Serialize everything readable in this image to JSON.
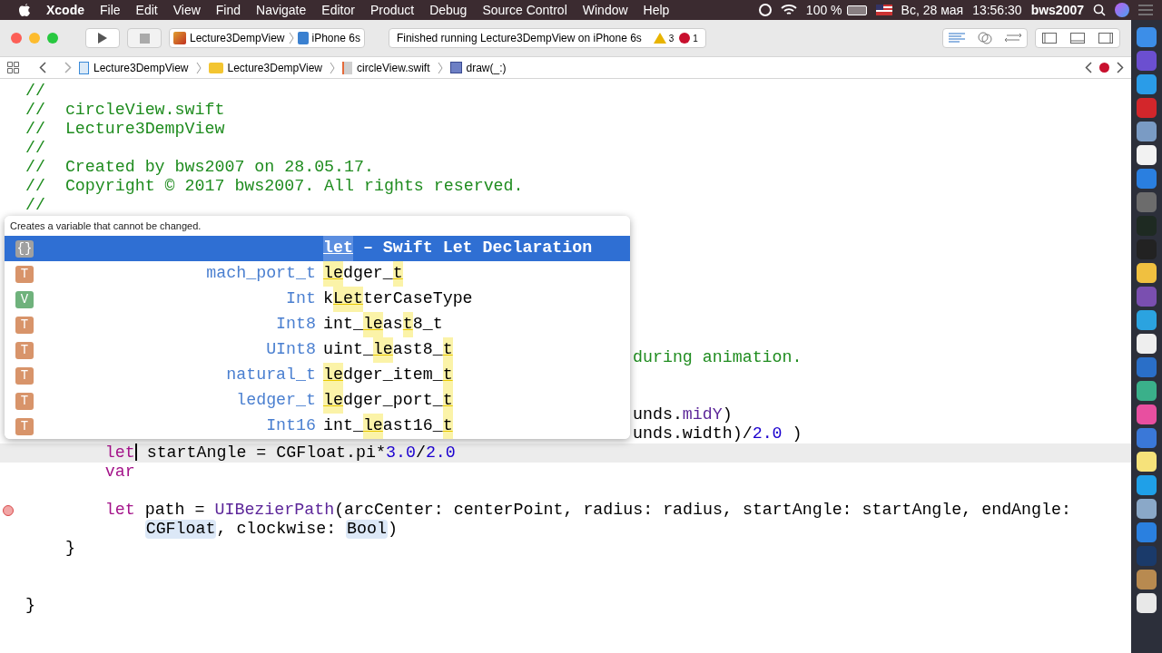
{
  "menu_bar": {
    "app": "Xcode",
    "items": [
      "File",
      "Edit",
      "View",
      "Find",
      "Navigate",
      "Editor",
      "Product",
      "Debug",
      "Source Control",
      "Window",
      "Help"
    ],
    "battery": "100 %",
    "date": "Вс, 28 мая",
    "time": "13:56:30",
    "user": "bws2007"
  },
  "toolbar": {
    "scheme": "Lecture3DempView",
    "device": "iPhone 6s",
    "status": "Finished running Lecture3DempView on iPhone 6s",
    "warnings": "3",
    "errors": "1"
  },
  "breadcrumbs": [
    {
      "kind": "project",
      "label": "Lecture3DempView"
    },
    {
      "kind": "folder",
      "label": "Lecture3DempView"
    },
    {
      "kind": "swift",
      "label": "circleView.swift"
    },
    {
      "kind": "method",
      "label": "draw(_:)"
    }
  ],
  "lines": [
    {
      "segments": [
        {
          "kind": "comment",
          "text": "//"
        }
      ]
    },
    {
      "segments": [
        {
          "kind": "comment",
          "text": "//  circleView.swift"
        }
      ]
    },
    {
      "segments": [
        {
          "kind": "comment",
          "text": "//  Lecture3DempView"
        }
      ]
    },
    {
      "segments": [
        {
          "kind": "comment",
          "text": "//"
        }
      ]
    },
    {
      "segments": [
        {
          "kind": "comment",
          "text": "//  Created by bws2007 on 28.05.17."
        }
      ]
    },
    {
      "segments": [
        {
          "kind": "comment",
          "text": "//  Copyright © 2017 bws2007. All rights reserved."
        }
      ]
    },
    {
      "segments": [
        {
          "kind": "comment",
          "text": "//"
        }
      ]
    },
    {
      "kind": "blank"
    },
    {
      "kind": "blank"
    },
    {
      "kind": "blank"
    },
    {
      "kind": "blank"
    },
    {
      "kind": "blank"
    },
    {
      "kind": "blank"
    },
    {
      "kind": "blank"
    },
    {
      "covered": true,
      "segments": [
        {
          "kind": "comment",
          "text": "during animation."
        }
      ]
    },
    {
      "kind": "blank"
    },
    {
      "kind": "blank"
    },
    {
      "covered": true,
      "segments": [
        {
          "kind": "plain",
          "text": "unds."
        },
        {
          "kind": "property",
          "text": "midY"
        },
        {
          "kind": "plain",
          "text": ")"
        }
      ]
    },
    {
      "covered": true,
      "segments": [
        {
          "kind": "plain",
          "text": "unds.width)/"
        },
        {
          "kind": "number",
          "text": "2.0"
        },
        {
          "kind": "plain",
          "text": " )"
        }
      ]
    },
    {
      "current": true,
      "segments": [
        {
          "kind": "keyword",
          "text": "        let",
          "caret_after": true
        },
        {
          "kind": "plain",
          "text": " startAngle = CGFloat.pi*"
        },
        {
          "kind": "number",
          "text": "3.0"
        },
        {
          "kind": "plain",
          "text": "/"
        },
        {
          "kind": "number",
          "text": "2.0"
        }
      ]
    },
    {
      "segments": [
        {
          "kind": "keyword",
          "text": "        var"
        }
      ]
    },
    {
      "kind": "blank"
    },
    {
      "error": true,
      "segments": [
        {
          "kind": "keyword",
          "text": "        let"
        },
        {
          "kind": "plain",
          "text": " path = "
        },
        {
          "kind": "type",
          "text": "UIBezierPath"
        },
        {
          "kind": "plain",
          "text": "(arcCenter: centerPoint, radius: radius, startAngle: startAngle, endAngle:"
        }
      ]
    },
    {
      "segments": [
        {
          "kind": "placeholder",
          "text": "            CGFloat"
        },
        {
          "kind": "plain",
          "text": ", clockwise: "
        },
        {
          "kind": "placeholder",
          "text": "Bool"
        },
        {
          "kind": "plain",
          "text": ")"
        }
      ]
    },
    {
      "segments": [
        {
          "kind": "plain",
          "text": "    }"
        }
      ]
    },
    {
      "kind": "blank"
    },
    {
      "kind": "blank"
    },
    {
      "segments": [
        {
          "kind": "plain",
          "text": "}"
        }
      ]
    }
  ],
  "completion": {
    "description": "Creates a variable that cannot be changed.",
    "items": [
      {
        "badge": "{}",
        "kind": "snippet",
        "selected": true,
        "name": [
          {
            "text": "let",
            "match": true
          }
        ],
        "detail": " – Swift Let Declaration"
      },
      {
        "badge": "T",
        "kind": "type",
        "selected": false,
        "type": "mach_port_t",
        "name": [
          {
            "text": "le",
            "match": true
          },
          {
            "text": "dger_",
            "match": false
          },
          {
            "text": "t",
            "match": true
          }
        ]
      },
      {
        "badge": "V",
        "kind": "var",
        "selected": false,
        "type": "Int",
        "name": [
          {
            "text": "k",
            "match": false
          },
          {
            "text": "Let",
            "match": true
          },
          {
            "text": "terCaseType",
            "match": false
          }
        ]
      },
      {
        "badge": "T",
        "kind": "type",
        "selected": false,
        "type": "Int8",
        "name": [
          {
            "text": "int_",
            "match": false
          },
          {
            "text": "le",
            "match": true
          },
          {
            "text": "as",
            "match": false
          },
          {
            "text": "t",
            "match": true
          },
          {
            "text": "8_t",
            "match": false
          }
        ]
      },
      {
        "badge": "T",
        "kind": "type",
        "selected": false,
        "type": "UInt8",
        "name": [
          {
            "text": "uint_",
            "match": false
          },
          {
            "text": "le",
            "match": true
          },
          {
            "text": "ast8_",
            "match": false
          },
          {
            "text": "t",
            "match": true
          }
        ]
      },
      {
        "badge": "T",
        "kind": "type",
        "selected": false,
        "type": "natural_t",
        "name": [
          {
            "text": "le",
            "match": true
          },
          {
            "text": "dger_item_",
            "match": false
          },
          {
            "text": "t",
            "match": true
          }
        ]
      },
      {
        "badge": "T",
        "kind": "type",
        "selected": false,
        "type": "ledger_t",
        "name": [
          {
            "text": "le",
            "match": true
          },
          {
            "text": "dger_port_",
            "match": false
          },
          {
            "text": "t",
            "match": true
          }
        ]
      },
      {
        "badge": "T",
        "kind": "type",
        "selected": false,
        "type": "Int16",
        "name": [
          {
            "text": "int_",
            "match": false
          },
          {
            "text": "le",
            "match": true
          },
          {
            "text": "ast16_",
            "match": false
          },
          {
            "text": "t",
            "match": true
          }
        ]
      }
    ]
  }
}
